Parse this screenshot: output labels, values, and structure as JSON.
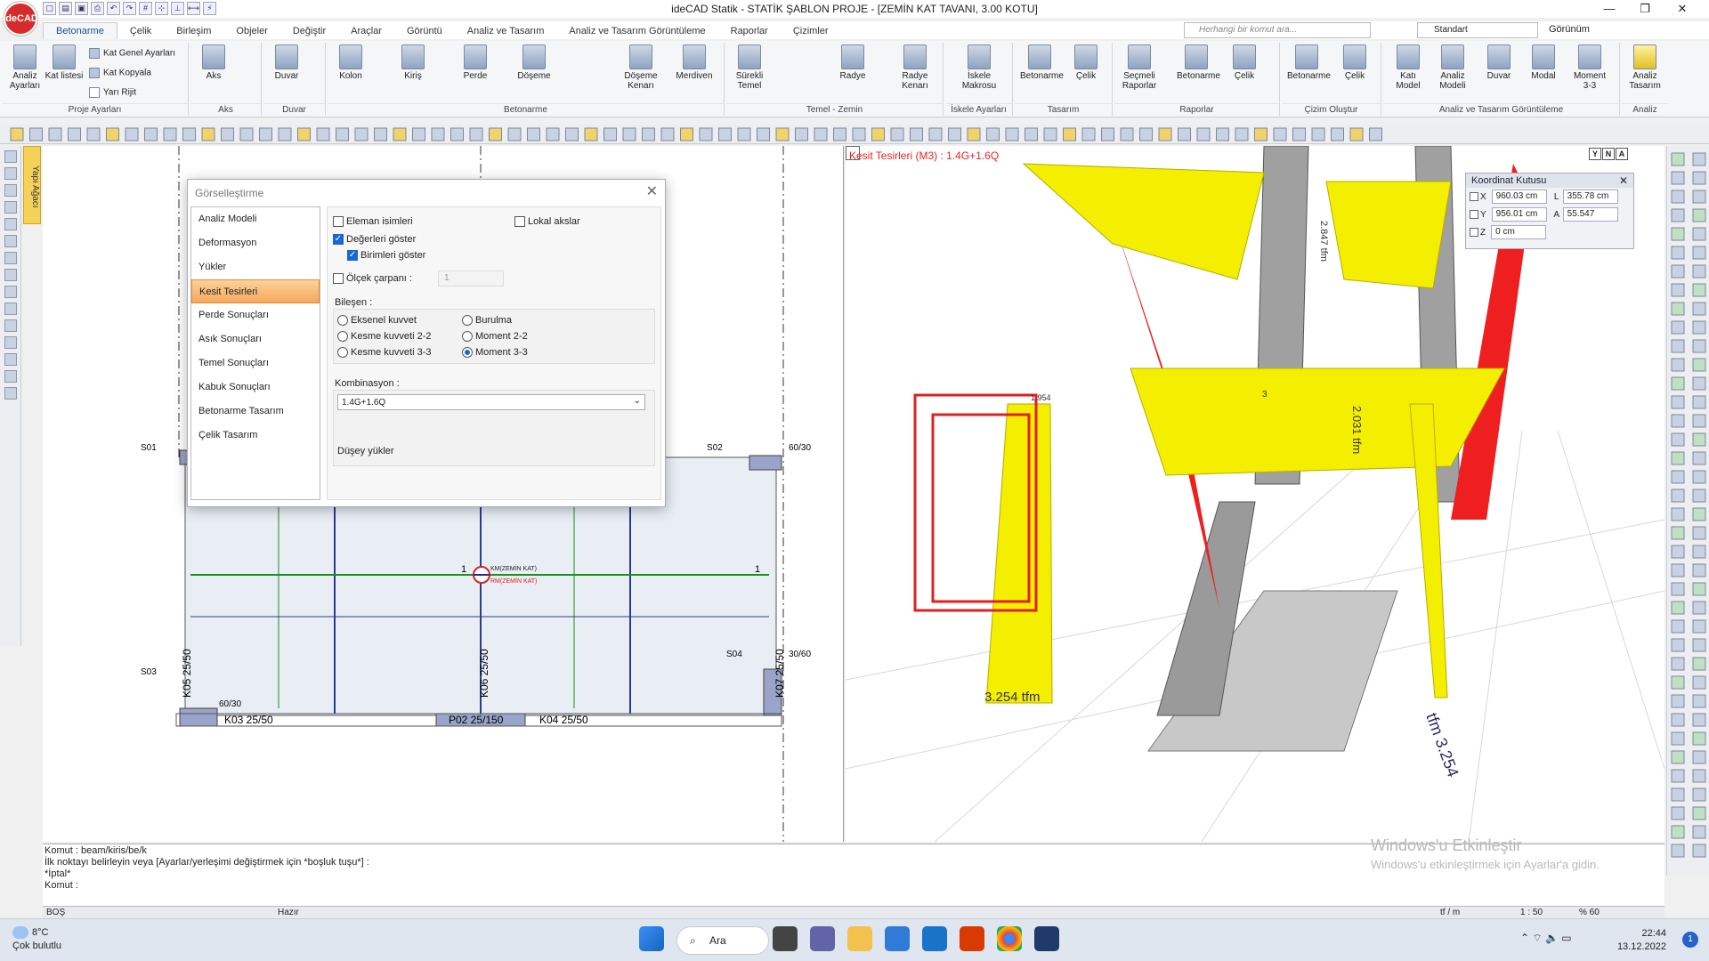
{
  "window": {
    "logo": "ideCAD",
    "title": "ideCAD Statik - STATİK ŞABLON PROJE - [ZEMİN KAT TAVANI,  3.00 KOTU]",
    "min": "—",
    "max": "❐",
    "close": "✕"
  },
  "tabs": [
    "Betonarme",
    "Çelik",
    "Birleşim",
    "Objeler",
    "Değiştir",
    "Araçlar",
    "Görüntü",
    "Analiz ve Tasarım",
    "Analiz ve Tasarım Görüntüleme",
    "Raporlar",
    "Çizimler"
  ],
  "header_right": {
    "search_placeholder": "Herhangi bir komut ara...",
    "style": "Standart",
    "view": "Görünüm"
  },
  "ribbon": {
    "proje": {
      "name": "Proje Ayarları",
      "analiz": "Analiz Ayarları",
      "kat": "Kat listesi",
      "s1": "Kat Genel Ayarları",
      "s2": "Kat Kopyala",
      "s3": "Yarı Rijit"
    },
    "aks": {
      "name": "Aks",
      "btn": "Aks"
    },
    "duvar": {
      "name": "Duvar",
      "btn": "Duvar"
    },
    "betonarme": {
      "name": "Betonarme",
      "kolon": "Kolon",
      "kiris": "Kiriş",
      "perde": "Perde",
      "doseme": "Döşeme",
      "doseme_kenari": "Döşeme Kenarı",
      "merdiven": "Merdiven"
    },
    "temel": {
      "name": "Temel - Zemin",
      "surekli": "Sürekli Temel",
      "radye": "Radye",
      "radye_kenari": "Radye Kenarı"
    },
    "iskele": {
      "name": "İskele Ayarları",
      "btn": "İskele Makrosu"
    },
    "tasarim": {
      "name": "Tasarım",
      "b1": "Betonarme",
      "b2": "Çelik"
    },
    "raporlar": {
      "name": "Raporlar",
      "b1": "Seçmeli Raporlar",
      "b2": "Betonarme",
      "b3": "Çelik"
    },
    "cizim": {
      "name": "Çizim Oluştur",
      "b1": "Betonarme",
      "b2": "Çelik"
    },
    "atg": {
      "name": "Analiz ve Tasarım Görüntüleme",
      "b1": "Katı Model",
      "b2": "Analiz Modeli",
      "b3": "Duvar",
      "b4": "Modal",
      "b5": "Moment 3-3"
    },
    "analiz": {
      "name": "Analiz",
      "b1": "Analiz Tasarım"
    }
  },
  "side_tab": "Yapı Ağacı",
  "dialog": {
    "title": "Görselleştirme",
    "nav": [
      "Analiz Modeli",
      "Deformasyon",
      "Yükler",
      "Kesit Tesirleri",
      "Perde Sonuçları",
      "Asık Sonuçları",
      "Temel Sonuçları",
      "Kabuk Sonuçları",
      "Betonarme Tasarım",
      "Çelik Tasarım"
    ],
    "active_nav": "Kesit Tesirleri",
    "options": {
      "eleman": "Eleman isimleri",
      "lokal": "Lokal akslar",
      "degerler": "Değerleri göster",
      "birimler": "Birimleri göster",
      "olcek": "Ölçek çarpanı :",
      "olcek_value": "1"
    },
    "bilesen_label": "Bileşen :",
    "components": [
      "Eksenel kuvvet",
      "Burulma",
      "Kesme kuvveti 2-2",
      "Moment 2-2",
      "Kesme kuvveti 3-3",
      "Moment 3-3"
    ],
    "selected_component": "Moment 3-3",
    "kombinasyon_label": "Kombinasyon :",
    "kombinasyon": "1.4G+1.6Q",
    "note": "Düşey yükler"
  },
  "plan": {
    "labels": {
      "s01": "S01",
      "s02": "S02",
      "s03": "S03",
      "s04": "S04",
      "c60_30a": "60/30",
      "c60_30b": "60/30",
      "c30_60": "30/60",
      "k05": "K05 25/50",
      "k06": "K06 25/50",
      "k07": "K07 25/50",
      "k03": "K03 25/50",
      "p02": "P02 25/150",
      "k04": "K04 25/50",
      "one_a": "1",
      "one_b": "1",
      "tag1": "KM(ZEMİN KAT)",
      "tag2": "RM(ZEMİN KAT)"
    }
  },
  "view3d": {
    "title": "Kesit Tesirleri (M3) : 1.4G+1.6Q",
    "v1": "2.847 tfm",
    "v2": "2.031 tfm",
    "v3": "3.254 tfm",
    "v4": "3",
    "v5": "tfm 3.254",
    "v6": "1.954",
    "axes": [
      "Y",
      "N",
      "A"
    ]
  },
  "coord": {
    "title": "Koordinat Kutusu",
    "x_lbl": "X",
    "x": "960.03 cm",
    "l_lbl": "L",
    "l": "355.78 cm",
    "y_lbl": "Y",
    "y": "956.01 cm",
    "a_lbl": "A",
    "a": "55.547",
    "z_lbl": "Z",
    "z": "0 cm"
  },
  "command": [
    "Komut : beam/kiris/be/k",
    "İlk noktayı belirleyin veya [Ayarlar/yerleşimi değiştirmek için *boşluk tuşu*] :",
    "*İptal*",
    "Komut :"
  ],
  "status": {
    "left": "BOŞ",
    "state": "Hazır",
    "unit": "tf / m",
    "scale": "1 : 50",
    "zoom": "% 60"
  },
  "watermark": {
    "line1": "Windows'u Etkinleştir",
    "line2": "Windows'u etkinleştirmek için Ayarlar'a gidin."
  },
  "taskbar": {
    "temp": "8°C",
    "weather": "Çok bulutlu",
    "search": "Ara",
    "time": "22:44",
    "date": "13.12.2022",
    "notif": "1"
  }
}
